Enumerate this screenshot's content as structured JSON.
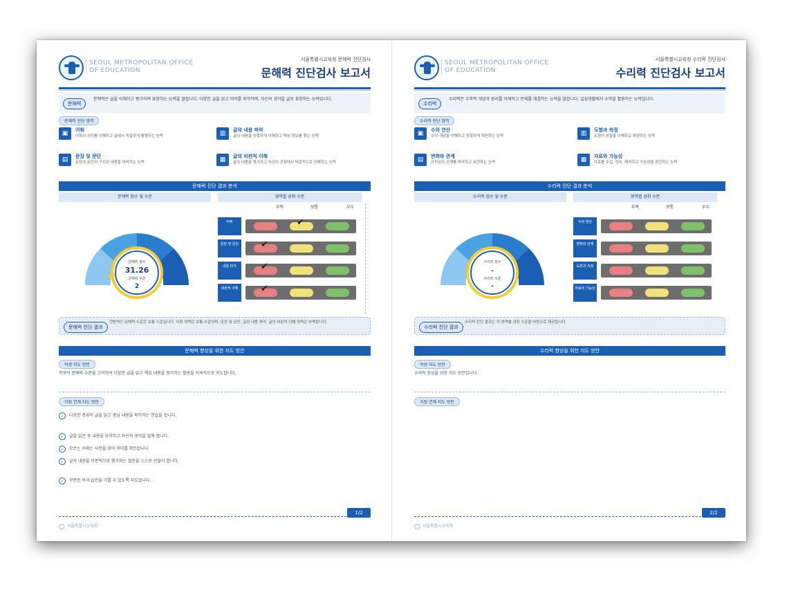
{
  "left": {
    "org": "SEOUL METROPOLITAN OFFICE\nOF EDUCATION",
    "subtitle": "서울특별시교육청 문해력 진단검사",
    "title": "문해력 진단검사 보고서",
    "intro_pill": "문해력",
    "intro_text": "문해력은 글을 이해하고 평가하며 표현하는 능력을 말합니다. 다양한 글을 읽고 의미를 파악하며, 자신의 생각을 글로 표현하는 능력입니다.",
    "areas_tag": "문해력 진단 영역",
    "areas": [
      {
        "icon": "▣",
        "name": "어휘",
        "desc": "어휘의 의미를 이해하고 글에서 적절하게 활용하는 능력"
      },
      {
        "icon": "▤",
        "name": "문장 및 문단",
        "desc": "문장과 문단의 구조와 내용을 파악하는 능력"
      },
      {
        "icon": "▥",
        "name": "글의 내용 파악",
        "desc": "글의 내용을 정확하게 이해하고 핵심 정보를 찾는 능력"
      },
      {
        "icon": "▦",
        "name": "글의 비판적 이해",
        "desc": "글의 내용을 평가하고 자신의 관점에서 비판적으로 이해하는 능력"
      }
    ],
    "band1": "문해력 진단 결과 분석",
    "col_left": "문해력 점수 및 수준",
    "col_right": "영역별 성취 수준",
    "lamp_heads": [
      "부족",
      "보통",
      "우수"
    ],
    "score_label": "문해력 점수",
    "score": "31.26",
    "level_label": "문해력 수준",
    "level": "2",
    "rows": [
      {
        "label": "어휘",
        "check": 1
      },
      {
        "label": "문장 및 문단",
        "check": 0
      },
      {
        "label": "내용 파악",
        "check": 0
      },
      {
        "label": "비판적 이해",
        "check": 0
      }
    ],
    "result_pill": "문해력 진단 결과",
    "result_text": "전반적인 문해력 수준은 보통 수준입니다. 어휘 영역은 보통 수준이며, 문장 및 문단, 글의 내용 파악, 글의 비판적 이해 영역은 부족합니다.",
    "band2": "문해력 향상을 위한 지도 방안",
    "guide_tag": "학생 지도 방안",
    "guide_text": "학생의 문해력 수준을 고려하여 다양한 글을 읽고 핵심 내용을 정리하는 활동을 지속적으로 지도합니다.",
    "tips_tag": "가정 연계 지도 방안",
    "tips": [
      "다양한 종류의 글을 읽고 중심 내용을 파악하는 연습을 합니다.",
      "글을 읽은 후 내용을 요약하고 자신의 생각을 말해 봅니다.",
      "모르는 어휘는 사전을 찾아 의미를 확인합니다.",
      "글의 내용을 비판적으로 평가하는 질문을 스스로 만들어 봅니다.",
      "꾸준한 독서 습관을 기를 수 있도록 지도합니다."
    ],
    "page_btn": "1/2",
    "footer": "서울특별시교육청"
  },
  "right": {
    "org": "SEOUL METROPOLITAN OFFICE\nOF EDUCATION",
    "subtitle": "서울특별시교육청 수리력 진단검사",
    "title": "수리력 진단검사 보고서",
    "intro_pill": "수리력",
    "intro_text": "수리력은 수학적 개념과 원리를 이해하고 문제를 해결하는 능력을 말합니다. 일상생활에서 수학을 활용하는 능력입니다.",
    "areas_tag": "수리력 진단 영역",
    "areas": [
      {
        "icon": "▣",
        "name": "수와 연산",
        "desc": "수의 개념을 이해하고 정확하게 계산하는 능력"
      },
      {
        "icon": "▤",
        "name": "변화와 관계",
        "desc": "규칙성과 관계를 파악하고 표현하는 능력"
      },
      {
        "icon": "▥",
        "name": "도형과 측정",
        "desc": "도형의 성질을 이해하고 측정하는 능력"
      },
      {
        "icon": "▦",
        "name": "자료와 가능성",
        "desc": "자료를 수집, 정리, 해석하고 가능성을 판단하는 능력"
      }
    ],
    "band1": "수리력 진단 결과 분석",
    "col_left": "수리력 점수 및 수준",
    "col_right": "영역별 성취 수준",
    "lamp_heads": [
      "부족",
      "보통",
      "우수"
    ],
    "score_label": "수리력 점수",
    "score": "-",
    "level_label": "수리력 수준",
    "level": "-",
    "rows": [
      {
        "label": "수와 연산"
      },
      {
        "label": "변화와 관계"
      },
      {
        "label": "도형과 측정"
      },
      {
        "label": "자료와 가능성"
      }
    ],
    "result_pill": "수리력 진단 결과",
    "result_text": "수리력 진단 결과는 각 영역별 성취 수준을 바탕으로 제공됩니다.",
    "band2": "수리력 향상을 위한 지도 방안",
    "guide_tag": "학생 지도 방안",
    "guide_text": "수리력 향상을 위한 지도 방안입니다.",
    "tips_tag": "가정 연계 지도 방안",
    "page_btn": "2/2",
    "footer": "서울특별시교육청"
  },
  "chart_data": [
    {
      "type": "gauge",
      "score": 31.26,
      "level": 2
    },
    {
      "type": "gauge"
    }
  ]
}
